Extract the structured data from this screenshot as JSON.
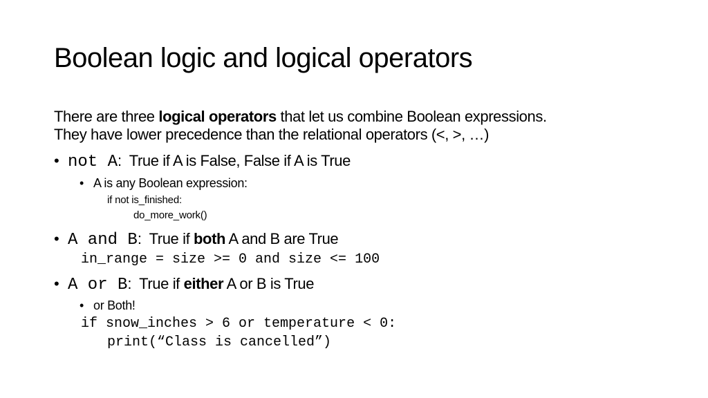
{
  "slide": {
    "title": "Boolean logic and logical operators",
    "intro": {
      "line1_pre": "There are three ",
      "line1_bold": "logical operators",
      "line1_post": " that let us combine Boolean expressions.",
      "line2": "They have lower precedence than the relational operators (<, >, …)"
    },
    "bullets": [
      {
        "code": "not A",
        "text_pre": ":  True if A is False, False if A is True",
        "sub": {
          "text": "A is any Boolean expression:",
          "code_lines": [
            "if not is_finished:",
            "do_more_work()"
          ]
        }
      },
      {
        "code": "A and B",
        "text_pre": ":  True if ",
        "bold": "both",
        "text_post": " A and B are True",
        "code_line": "in_range = size >= 0 and size <= 100"
      },
      {
        "code": "A or B",
        "text_pre": ":  True if ",
        "bold": "either",
        "text_post": " A or B is True",
        "sub": {
          "text": "or Both!"
        },
        "code_lines": [
          "if snow_inches > 6 or temperature < 0:",
          "print(“Class is cancelled”)"
        ]
      }
    ],
    "bullet_glyph": "•"
  }
}
